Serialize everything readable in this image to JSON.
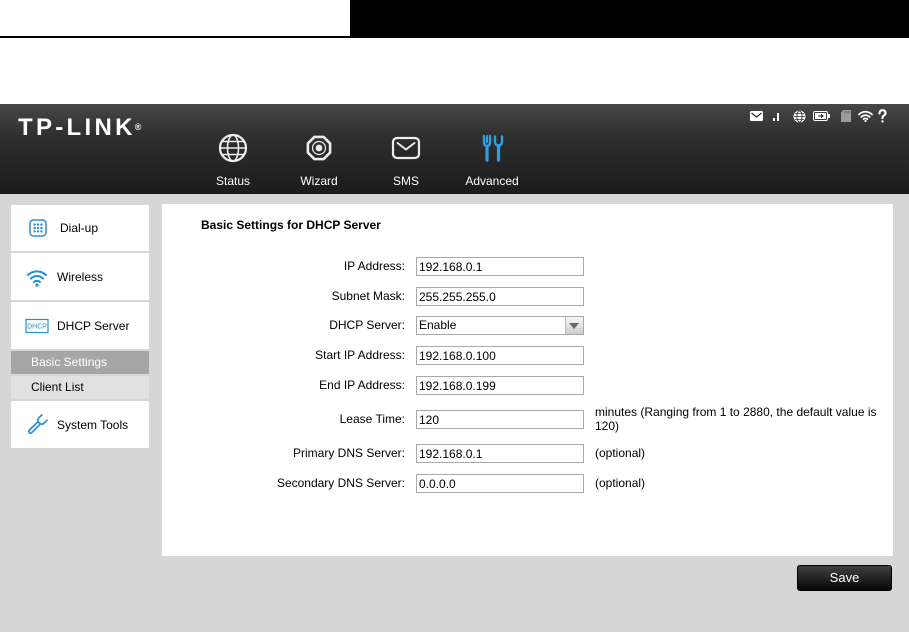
{
  "brand": {
    "logo": "TP-LINK",
    "logo_mark": "®"
  },
  "status_bar": {
    "icons": [
      "envelope-icon",
      "signal-icon",
      "globe-icon",
      "battery-icon",
      "sd-card-icon",
      "wifi-icon",
      "help-icon"
    ]
  },
  "nav": [
    {
      "label": "Status",
      "icon": "globe-icon",
      "active": false
    },
    {
      "label": "Wizard",
      "icon": "wizard-icon",
      "active": false
    },
    {
      "label": "SMS",
      "icon": "envelope-icon",
      "active": false
    },
    {
      "label": "Advanced",
      "icon": "tools-icon",
      "active": true
    }
  ],
  "sidebar": {
    "items": [
      {
        "label": "Dial-up",
        "icon": "keypad-icon"
      },
      {
        "label": "Wireless",
        "icon": "wifi-icon"
      },
      {
        "label": "DHCP Server",
        "icon": "dhcp-icon",
        "icon_text": "DHCP",
        "expanded": true,
        "children": [
          {
            "label": "Basic Settings",
            "selected": true
          },
          {
            "label": "Client List",
            "selected": false
          }
        ]
      },
      {
        "label": "System Tools",
        "icon": "wrench-icon"
      }
    ]
  },
  "main": {
    "title": "Basic Settings for DHCP Server",
    "fields": [
      {
        "label": "IP Address:",
        "value": "192.168.0.1"
      },
      {
        "label": "Subnet Mask:",
        "value": "255.255.255.0"
      },
      {
        "label": "DHCP Server:",
        "value": "Enable"
      },
      {
        "label": "Start IP Address:",
        "value": "192.168.0.100"
      },
      {
        "label": "End IP Address:",
        "value": "192.168.0.199"
      },
      {
        "label": "Lease Time:",
        "value": "120",
        "note": "minutes (Ranging from 1 to 2880, the default value is 120)"
      },
      {
        "label": "Primary DNS Server:",
        "value": "192.168.0.1",
        "note": "(optional)"
      },
      {
        "label": "Secondary DNS Server:",
        "value": "0.0.0.0",
        "note": "(optional)"
      }
    ]
  },
  "actions": {
    "save_label": "Save"
  },
  "colors": {
    "accent": "#2a8fd4",
    "header": "#262626",
    "page_bg": "#d6d6d6",
    "selected_item": "#a6a6a6",
    "button": "#111111"
  }
}
